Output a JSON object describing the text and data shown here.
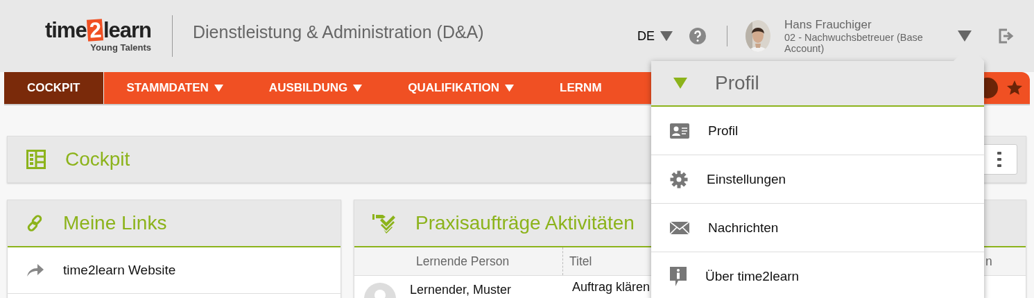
{
  "logo": {
    "before": "time",
    "mark": "2",
    "after": "learn",
    "tagline": "Young Talents"
  },
  "header": {
    "title": "Dienstleistung & Administration (D&A)",
    "language": "DE",
    "user": {
      "name": "Hans Frauchiger",
      "role": "02 - Nachwuchsbetreuer (Base Account)"
    }
  },
  "nav": [
    {
      "label": "COCKPIT",
      "selected": true,
      "has_menu": false
    },
    {
      "label": "STAMMDATEN",
      "selected": false,
      "has_menu": true
    },
    {
      "label": "AUSBILDUNG",
      "selected": false,
      "has_menu": true
    },
    {
      "label": "QUALIFIKATION",
      "selected": false,
      "has_menu": true
    },
    {
      "label": "LERNM",
      "selected": false,
      "has_menu": false
    }
  ],
  "page_title": "Cockpit",
  "links_panel": {
    "title": "Meine Links",
    "items": [
      "time2learn Website"
    ]
  },
  "activities_panel": {
    "title": "Praxisaufträge Aktivitäten",
    "columns": [
      "Lernende Person",
      "Titel",
      "n"
    ],
    "rows": [
      {
        "person": "Lernender, Muster",
        "title": "Auftrag klären"
      }
    ]
  },
  "profile_menu": {
    "title": "Profil",
    "expanded": true,
    "items": [
      "Profil",
      "Einstellungen",
      "Nachrichten",
      "Über time2learn"
    ]
  }
}
